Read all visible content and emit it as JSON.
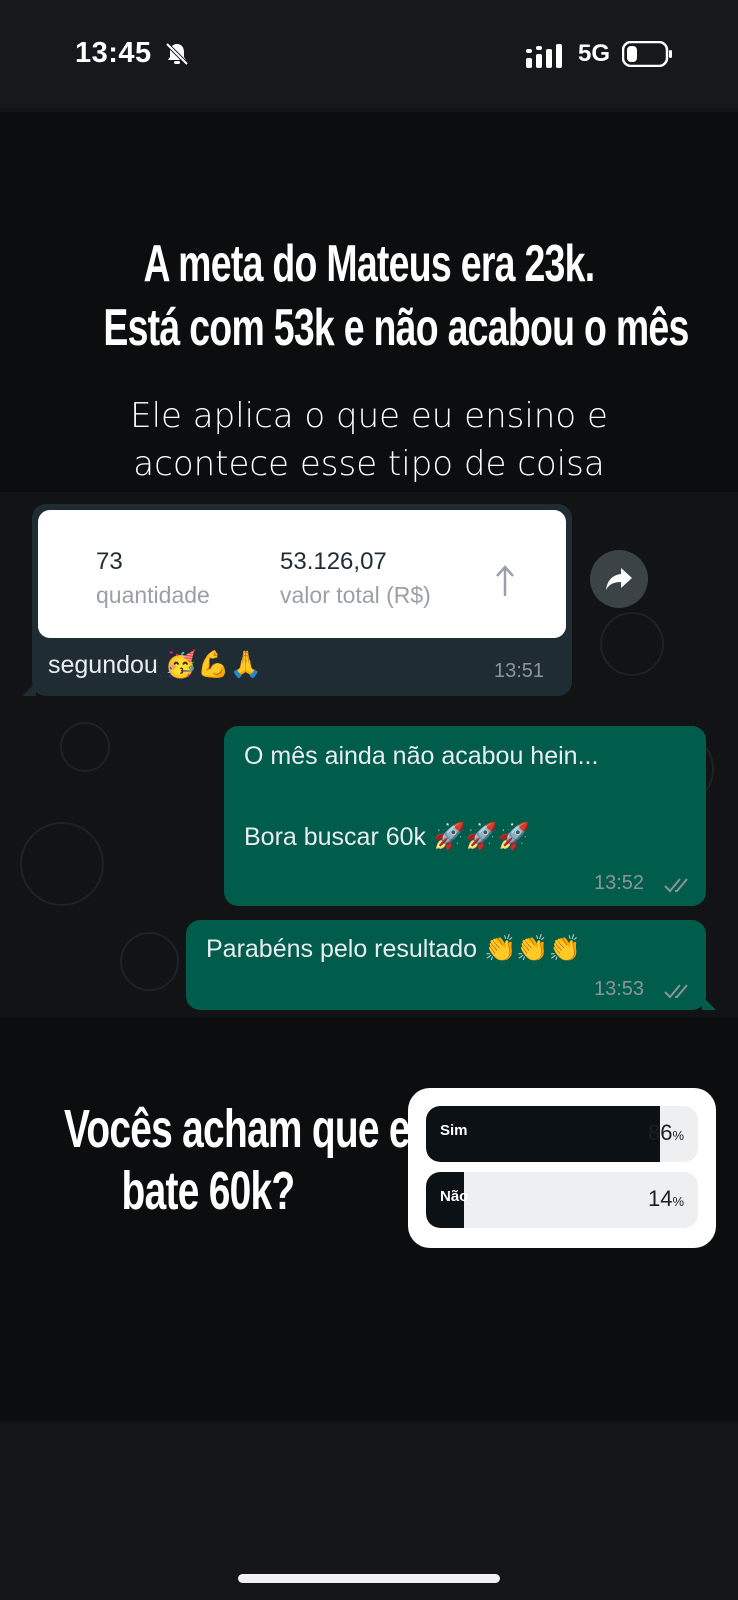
{
  "status_bar": {
    "time": "13:45",
    "network": "5G",
    "icons": [
      "bell-slash-icon",
      "signal-icon",
      "battery-icon"
    ]
  },
  "story": {
    "headline_line1": "A meta do Mateus era 23k.",
    "headline_line2": "Está com 53k e não acabou o mês",
    "subline_line1": "Ele aplica o que eu ensino e",
    "subline_line2": "acontece esse tipo de coisa"
  },
  "chat": {
    "incoming": {
      "card": {
        "quantity_value": "73",
        "quantity_label": "quantidade",
        "total_value": "53.126,07",
        "total_label": "valor total (R$)"
      },
      "text": "segundou",
      "emojis": "🥳💪🙏",
      "time": "13:51"
    },
    "outgoing": [
      {
        "line1": "O mês ainda não acabou hein...",
        "line2": "Bora buscar 60k",
        "emojis": "🚀🚀🚀",
        "time": "13:52",
        "status": "read"
      },
      {
        "line1": "Parabéns pelo resultado",
        "emojis": "👏👏👏",
        "time": "13:53",
        "status": "read"
      }
    ]
  },
  "poll": {
    "question_line1": "Vocês acham que ele",
    "question_line2": "bate 60k?",
    "options": [
      {
        "label": "Sim",
        "percent": 86,
        "percent_text": "86"
      },
      {
        "label": "Não",
        "percent": 14,
        "percent_text": "14"
      }
    ],
    "percent_sign": "%"
  },
  "colors": {
    "outgoing_bubble": "#005c4b",
    "incoming_bubble": "#202c33",
    "poll_fill": "#0b1114"
  }
}
